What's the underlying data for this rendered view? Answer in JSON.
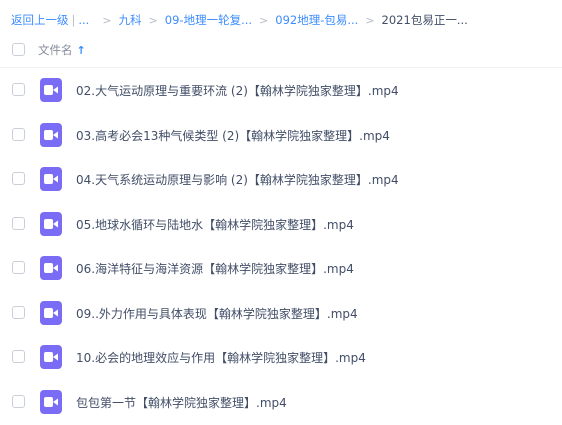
{
  "breadcrumb": {
    "back_label": "返回上一级",
    "separator": "|",
    "ellipsis": "...",
    "chevron": ">",
    "items": [
      {
        "label": "九科"
      },
      {
        "label": "09-地理一轮复..."
      },
      {
        "label": "092地理-包易..."
      }
    ],
    "current": "2021包易正一..."
  },
  "header": {
    "column_name": "文件名",
    "sort_indicator": "↑"
  },
  "colors": {
    "accent": "#3b8cff",
    "video_icon": "#7b6cf5",
    "text": "#424e67",
    "muted": "#878c9c"
  },
  "files": [
    {
      "name": "02.大气运动原理与重要环流 (2)【翰林学院独家整理】.mp4",
      "icon": "video-file-icon"
    },
    {
      "name": "03.高考必会13种气候类型 (2)【翰林学院独家整理】.mp4",
      "icon": "video-file-icon"
    },
    {
      "name": "04.天气系统运动原理与影响 (2)【翰林学院独家整理】.mp4",
      "icon": "video-file-icon"
    },
    {
      "name": "05.地球水循环与陆地水【翰林学院独家整理】.mp4",
      "icon": "video-file-icon"
    },
    {
      "name": "06.海洋特征与海洋资源【翰林学院独家整理】.mp4",
      "icon": "video-file-icon"
    },
    {
      "name": "09..外力作用与具体表现【翰林学院独家整理】.mp4",
      "icon": "video-file-icon"
    },
    {
      "name": "10.必会的地理效应与作用【翰林学院独家整理】.mp4",
      "icon": "video-file-icon"
    },
    {
      "name": "包包第一节【翰林学院独家整理】.mp4",
      "icon": "video-file-icon"
    }
  ]
}
